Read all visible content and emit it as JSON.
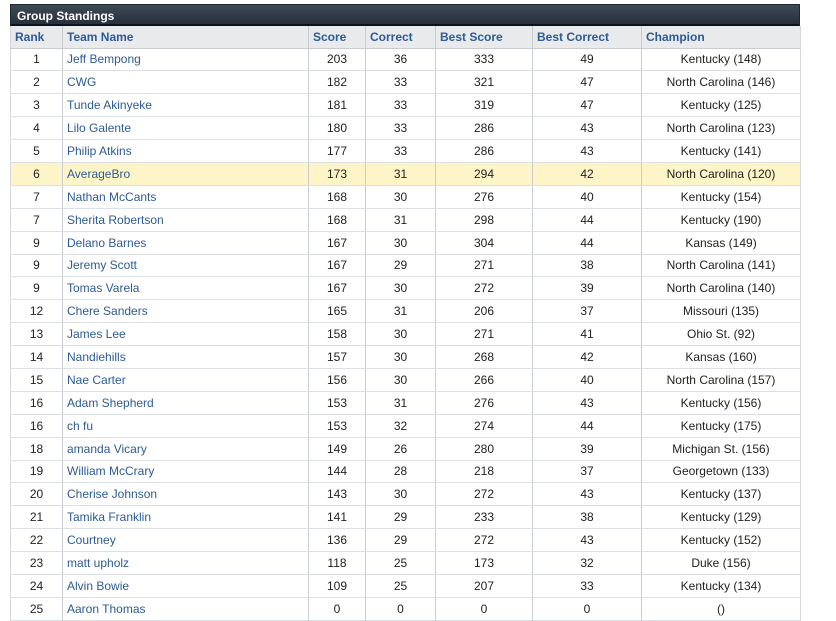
{
  "panel": {
    "title": "Group Standings"
  },
  "columns": {
    "rank": "Rank",
    "team": "Team Name",
    "score": "Score",
    "correct": "Correct",
    "best_score": "Best Score",
    "best_correct": "Best Correct",
    "champion": "Champion"
  },
  "highlight_color": "#fdf5c8",
  "link_color": "#2d5b94",
  "rows": [
    {
      "rank": "1",
      "team": "Jeff Bempong",
      "score": "203",
      "correct": "36",
      "best_score": "333",
      "best_correct": "49",
      "champion": "Kentucky (148)",
      "highlight": false
    },
    {
      "rank": "2",
      "team": "CWG",
      "score": "182",
      "correct": "33",
      "best_score": "321",
      "best_correct": "47",
      "champion": "North Carolina (146)",
      "highlight": false
    },
    {
      "rank": "3",
      "team": "Tunde Akinyeke",
      "score": "181",
      "correct": "33",
      "best_score": "319",
      "best_correct": "47",
      "champion": "Kentucky (125)",
      "highlight": false
    },
    {
      "rank": "4",
      "team": "Lilo Galente",
      "score": "180",
      "correct": "33",
      "best_score": "286",
      "best_correct": "43",
      "champion": "North Carolina (123)",
      "highlight": false
    },
    {
      "rank": "5",
      "team": "Philip Atkins",
      "score": "177",
      "correct": "33",
      "best_score": "286",
      "best_correct": "43",
      "champion": "Kentucky (141)",
      "highlight": false
    },
    {
      "rank": "6",
      "team": "AverageBro",
      "score": "173",
      "correct": "31",
      "best_score": "294",
      "best_correct": "42",
      "champion": "North Carolina (120)",
      "highlight": true
    },
    {
      "rank": "7",
      "team": "Nathan McCants",
      "score": "168",
      "correct": "30",
      "best_score": "276",
      "best_correct": "40",
      "champion": "Kentucky (154)",
      "highlight": false
    },
    {
      "rank": "7",
      "team": "Sherita Robertson",
      "score": "168",
      "correct": "31",
      "best_score": "298",
      "best_correct": "44",
      "champion": "Kentucky (190)",
      "highlight": false
    },
    {
      "rank": "9",
      "team": "Delano Barnes",
      "score": "167",
      "correct": "30",
      "best_score": "304",
      "best_correct": "44",
      "champion": "Kansas (149)",
      "highlight": false
    },
    {
      "rank": "9",
      "team": "Jeremy Scott",
      "score": "167",
      "correct": "29",
      "best_score": "271",
      "best_correct": "38",
      "champion": "North Carolina (141)",
      "highlight": false
    },
    {
      "rank": "9",
      "team": "Tomas Varela",
      "score": "167",
      "correct": "30",
      "best_score": "272",
      "best_correct": "39",
      "champion": "North Carolina (140)",
      "highlight": false
    },
    {
      "rank": "12",
      "team": "Chere Sanders",
      "score": "165",
      "correct": "31",
      "best_score": "206",
      "best_correct": "37",
      "champion": "Missouri (135)",
      "highlight": false
    },
    {
      "rank": "13",
      "team": "James Lee",
      "score": "158",
      "correct": "30",
      "best_score": "271",
      "best_correct": "41",
      "champion": "Ohio St. (92)",
      "highlight": false
    },
    {
      "rank": "14",
      "team": "Nandiehills",
      "score": "157",
      "correct": "30",
      "best_score": "268",
      "best_correct": "42",
      "champion": "Kansas (160)",
      "highlight": false
    },
    {
      "rank": "15",
      "team": "Nae Carter",
      "score": "156",
      "correct": "30",
      "best_score": "266",
      "best_correct": "40",
      "champion": "North Carolina (157)",
      "highlight": false
    },
    {
      "rank": "16",
      "team": "Adam Shepherd",
      "score": "153",
      "correct": "31",
      "best_score": "276",
      "best_correct": "43",
      "champion": "Kentucky (156)",
      "highlight": false
    },
    {
      "rank": "16",
      "team": "ch fu",
      "score": "153",
      "correct": "32",
      "best_score": "274",
      "best_correct": "44",
      "champion": "Kentucky (175)",
      "highlight": false
    },
    {
      "rank": "18",
      "team": "amanda Vicary",
      "score": "149",
      "correct": "26",
      "best_score": "280",
      "best_correct": "39",
      "champion": "Michigan St. (156)",
      "highlight": false
    },
    {
      "rank": "19",
      "team": "William McCrary",
      "score": "144",
      "correct": "28",
      "best_score": "218",
      "best_correct": "37",
      "champion": "Georgetown (133)",
      "highlight": false
    },
    {
      "rank": "20",
      "team": "Cherise Johnson",
      "score": "143",
      "correct": "30",
      "best_score": "272",
      "best_correct": "43",
      "champion": "Kentucky (137)",
      "highlight": false
    },
    {
      "rank": "21",
      "team": "Tamika Franklin",
      "score": "141",
      "correct": "29",
      "best_score": "233",
      "best_correct": "38",
      "champion": "Kentucky (129)",
      "highlight": false
    },
    {
      "rank": "22",
      "team": "Courtney",
      "score": "136",
      "correct": "29",
      "best_score": "272",
      "best_correct": "43",
      "champion": "Kentucky (152)",
      "highlight": false
    },
    {
      "rank": "23",
      "team": "matt upholz",
      "score": "118",
      "correct": "25",
      "best_score": "173",
      "best_correct": "32",
      "champion": "Duke (156)",
      "highlight": false
    },
    {
      "rank": "24",
      "team": "Alvin Bowie",
      "score": "109",
      "correct": "25",
      "best_score": "207",
      "best_correct": "33",
      "champion": "Kentucky (134)",
      "highlight": false
    },
    {
      "rank": "25",
      "team": "Aaron Thomas",
      "score": "0",
      "correct": "0",
      "best_score": "0",
      "best_correct": "0",
      "champion": "()",
      "highlight": false
    }
  ]
}
